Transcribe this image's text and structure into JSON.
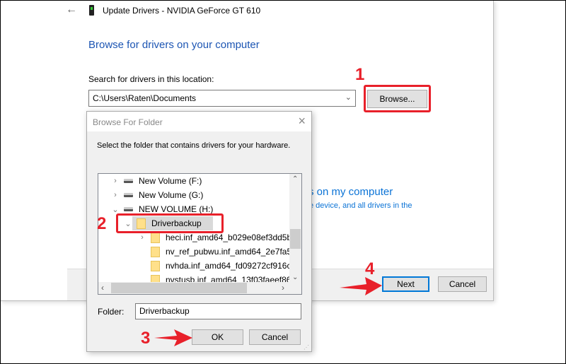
{
  "window": {
    "title": "Update Drivers - NVIDIA GeForce GT 610",
    "heading": "Browse for drivers on your computer",
    "search_label": "Search for drivers in this location:",
    "path_value": "C:\\Users\\Raten\\Documents",
    "browse_label": "Browse...",
    "partial_link_title": "s on my computer",
    "partial_link_desc": "e device, and all drivers in the",
    "next_label": "Next",
    "cancel_label": "Cancel"
  },
  "dialog": {
    "title": "Browse For Folder",
    "instruction": "Select the folder that contains drivers for your hardware.",
    "tree": [
      {
        "label": "New Volume (F:)",
        "type": "drive",
        "expander": "collapsed"
      },
      {
        "label": "New Volume (G:)",
        "type": "drive",
        "expander": "collapsed"
      },
      {
        "label": "NEW VOLUME (H:)",
        "type": "drive",
        "expander": "expanded"
      },
      {
        "label": "Driverbackup",
        "type": "folder",
        "expander": "expanded",
        "selected": true
      },
      {
        "label": "heci.inf_amd64_b029e08ef3dd5b",
        "type": "folder",
        "expander": "collapsed"
      },
      {
        "label": "nv_ref_pubwu.inf_amd64_2e7fa5",
        "type": "folder",
        "expander": "none"
      },
      {
        "label": "nvhda.inf_amd64_fd09272cf916c",
        "type": "folder",
        "expander": "none"
      },
      {
        "label": "nvstusb.inf_amd64_13f03faeef86",
        "type": "folder",
        "expander": "none"
      }
    ],
    "folder_label": "Folder:",
    "folder_value": "Driverbackup",
    "ok_label": "OK",
    "cancel_label": "Cancel"
  },
  "annotations": {
    "step1": "1",
    "step2": "2",
    "step3": "3",
    "step4": "4",
    "color": "#e8202a"
  },
  "colors": {
    "heading": "#1c55b3",
    "link": "#0b73d6",
    "dialog_bg": "#f0f0f0",
    "selection": "#d9d9d9",
    "default_button_border": "#0078d7"
  }
}
